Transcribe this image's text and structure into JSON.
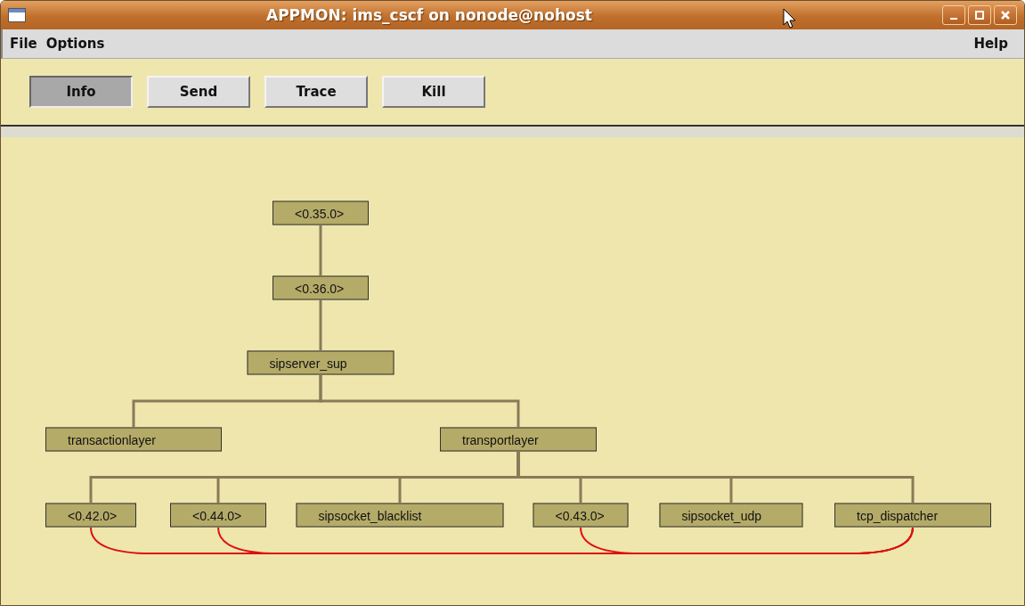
{
  "window": {
    "title": "APPMON: ims_cscf on nonode@nohost"
  },
  "menu": {
    "left": [
      "File",
      "Options"
    ],
    "right": [
      "Help"
    ]
  },
  "toolbar": [
    {
      "label": "Info",
      "selected": true
    },
    {
      "label": "Send",
      "selected": false
    },
    {
      "label": "Trace",
      "selected": false
    },
    {
      "label": "Kill",
      "selected": false
    }
  ],
  "tree": {
    "label": "<0.35.0>",
    "children": [
      {
        "label": "<0.36.0>",
        "children": [
          {
            "label": "sipserver_sup",
            "children": [
              {
                "label": "transactionlayer"
              },
              {
                "label": "transportlayer",
                "children": [
                  {
                    "label": "<0.42.0>",
                    "linked": true
                  },
                  {
                    "label": "<0.44.0>",
                    "linked": true
                  },
                  {
                    "label": "sipsocket_blacklist"
                  },
                  {
                    "label": "<0.43.0>",
                    "linked": true
                  },
                  {
                    "label": "sipsocket_udp"
                  },
                  {
                    "label": "tcp_dispatcher",
                    "link_target": true
                  }
                ]
              }
            ]
          }
        ]
      }
    ]
  }
}
